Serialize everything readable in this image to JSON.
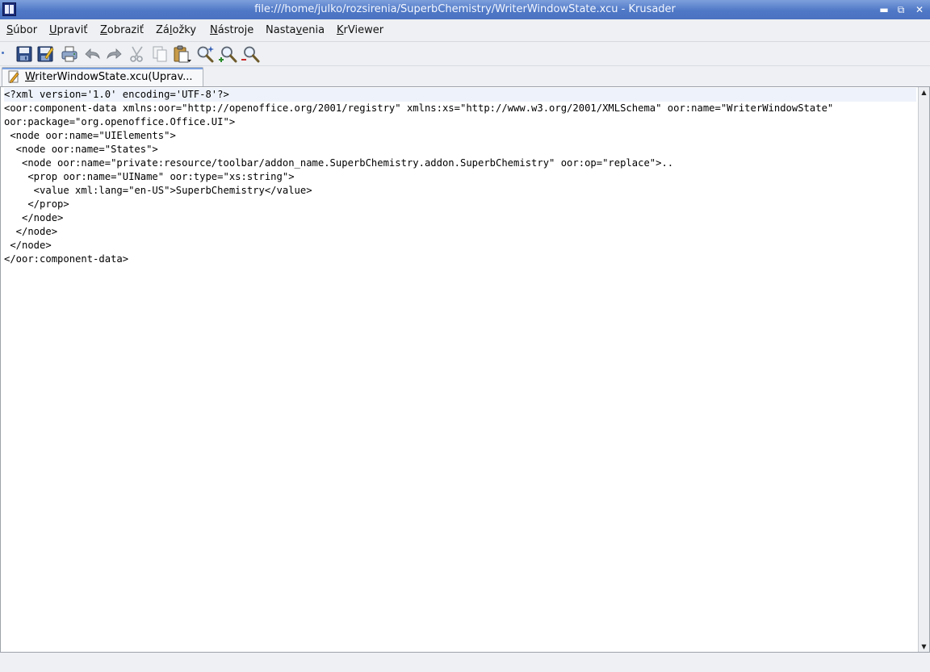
{
  "window": {
    "title": "file:///home/julko/rozsirenia/SuperbChemistry/WriterWindowState.xcu - Krusader",
    "minimize_glyph": "▬",
    "maximize_glyph": "⧉",
    "close_glyph": "✕"
  },
  "menu": [
    {
      "name": "subor",
      "ul": "S",
      "rest": "úbor"
    },
    {
      "name": "upravit",
      "ul": "U",
      "rest": "praviť"
    },
    {
      "name": "zobrazit",
      "ul": "Z",
      "rest": "obraziť"
    },
    {
      "name": "zalozky",
      "pre": "Zá",
      "ul": "l",
      "rest": "ožky"
    },
    {
      "name": "nastroje",
      "ul": "N",
      "rest": "ástroje"
    },
    {
      "name": "nastavenia",
      "pre": "Nasta",
      "ul": "v",
      "rest": "enia"
    },
    {
      "name": "krviewer",
      "ul": "K",
      "rest": "rViewer"
    }
  ],
  "toolbar": {
    "icons": [
      "save-icon",
      "save-as-icon",
      "print-icon",
      "undo-icon",
      "redo-icon",
      "cut-icon",
      "copy-icon",
      "paste-icon",
      "find-icon",
      "zoom-in-icon",
      "zoom-out-icon"
    ]
  },
  "tab": {
    "first_letter": "W",
    "label_rest": "riterWindowState.xcu(Uprav..."
  },
  "editor": {
    "lines": [
      "<?xml version='1.0' encoding='UTF-8'?>",
      "<oor:component-data xmlns:oor=\"http://openoffice.org/2001/registry\" xmlns:xs=\"http://www.w3.org/2001/XMLSchema\" oor:name=\"WriterWindowState\"",
      "oor:package=\"org.openoffice.Office.UI\">",
      " <node oor:name=\"UIElements\">",
      "  <node oor:name=\"States\">",
      "   <node oor:name=\"private:resource/toolbar/addon_name.SuperbChemistry.addon.SuperbChemistry\" oor:op=\"replace\">..",
      "    <prop oor:name=\"UIName\" oor:type=\"xs:string\">",
      "     <value xml:lang=\"en-US\">SuperbChemistry</value>",
      "    </prop>",
      "   </node>",
      "  </node>",
      " </node>",
      "</oor:component-data>"
    ],
    "current_line": 0
  },
  "colors": {
    "titlebar": "#4f78c6",
    "background": "#eef0f3",
    "editor_bg": "#ffffff"
  }
}
